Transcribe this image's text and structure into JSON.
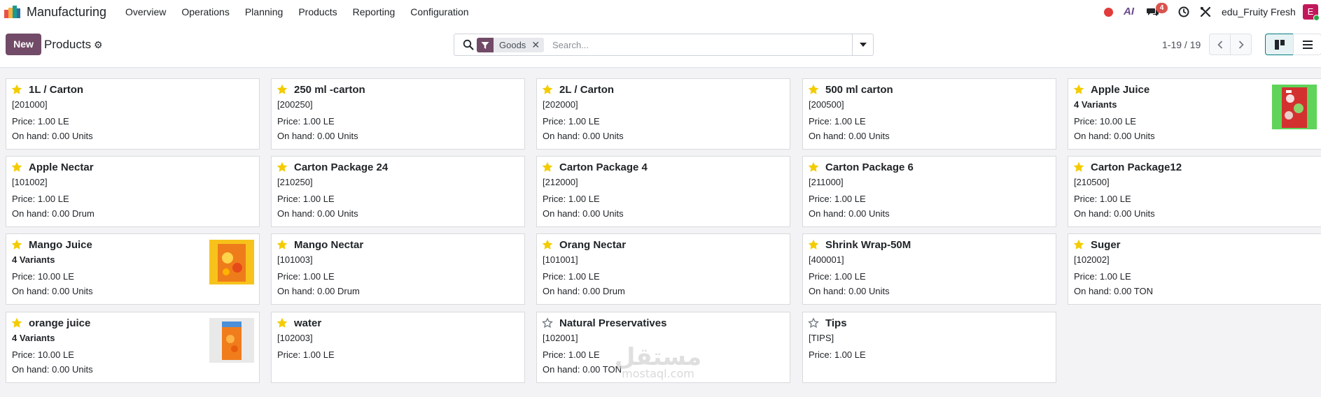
{
  "navbar": {
    "app_name": "Manufacturing",
    "menu": [
      "Overview",
      "Operations",
      "Planning",
      "Products",
      "Reporting",
      "Configuration"
    ],
    "ai_label": "AI",
    "chat_badge": "4",
    "company": "edu_Fruity Fresh",
    "avatar_letter": "E"
  },
  "control": {
    "new_label": "New",
    "title": "Products",
    "facet_label": "Goods",
    "search_placeholder": "Search...",
    "pager": "1-19 / 19"
  },
  "cards": [
    {
      "name": "1L / Carton",
      "line2": "[201000]",
      "line2_bold": false,
      "price": "Price: 1.00 LE",
      "onhand": "On hand: 0.00 Units",
      "starred": true,
      "thumb": ""
    },
    {
      "name": "250 ml -carton",
      "line2": "[200250]",
      "line2_bold": false,
      "price": "Price: 1.00 LE",
      "onhand": "On hand: 0.00 Units",
      "starred": true,
      "thumb": ""
    },
    {
      "name": "2L / Carton",
      "line2": "[202000]",
      "line2_bold": false,
      "price": "Price: 1.00 LE",
      "onhand": "On hand: 0.00 Units",
      "starred": true,
      "thumb": ""
    },
    {
      "name": "500 ml carton",
      "line2": "[200500]",
      "line2_bold": false,
      "price": "Price: 1.00 LE",
      "onhand": "On hand: 0.00 Units",
      "starred": true,
      "thumb": ""
    },
    {
      "name": "Apple Juice",
      "line2": "4 Variants",
      "line2_bold": true,
      "price": "Price: 10.00 LE",
      "onhand": "On hand: 0.00 Units",
      "starred": true,
      "thumb": "apple"
    },
    {
      "name": "Apple Nectar",
      "line2": "[101002]",
      "line2_bold": false,
      "price": "Price: 1.00 LE",
      "onhand": "On hand: 0.00 Drum",
      "starred": true,
      "thumb": ""
    },
    {
      "name": "Carton Package 24",
      "line2": "[210250]",
      "line2_bold": false,
      "price": "Price: 1.00 LE",
      "onhand": "On hand: 0.00 Units",
      "starred": true,
      "thumb": ""
    },
    {
      "name": "Carton Package 4",
      "line2": "[212000]",
      "line2_bold": false,
      "price": "Price: 1.00 LE",
      "onhand": "On hand: 0.00 Units",
      "starred": true,
      "thumb": ""
    },
    {
      "name": "Carton Package 6",
      "line2": "[211000]",
      "line2_bold": false,
      "price": "Price: 1.00 LE",
      "onhand": "On hand: 0.00 Units",
      "starred": true,
      "thumb": ""
    },
    {
      "name": "Carton Package12",
      "line2": "[210500]",
      "line2_bold": false,
      "price": "Price: 1.00 LE",
      "onhand": "On hand: 0.00 Units",
      "starred": true,
      "thumb": ""
    },
    {
      "name": "Mango Juice",
      "line2": "4 Variants",
      "line2_bold": true,
      "price": "Price: 10.00 LE",
      "onhand": "On hand: 0.00 Units",
      "starred": true,
      "thumb": "mango"
    },
    {
      "name": "Mango Nectar",
      "line2": "[101003]",
      "line2_bold": false,
      "price": "Price: 1.00 LE",
      "onhand": "On hand: 0.00 Drum",
      "starred": true,
      "thumb": ""
    },
    {
      "name": "Orang Nectar",
      "line2": "[101001]",
      "line2_bold": false,
      "price": "Price: 1.00 LE",
      "onhand": "On hand: 0.00 Drum",
      "starred": true,
      "thumb": ""
    },
    {
      "name": "Shrink Wrap-50M",
      "line2": "[400001]",
      "line2_bold": false,
      "price": "Price: 1.00 LE",
      "onhand": "On hand: 0.00 Units",
      "starred": true,
      "thumb": ""
    },
    {
      "name": "Suger",
      "line2": "[102002]",
      "line2_bold": false,
      "price": "Price: 1.00 LE",
      "onhand": "On hand: 0.00 TON",
      "starred": true,
      "thumb": ""
    },
    {
      "name": "orange juice",
      "line2": "4 Variants",
      "line2_bold": true,
      "price": "Price: 10.00 LE",
      "onhand": "On hand: 0.00 Units",
      "starred": true,
      "thumb": "orange"
    },
    {
      "name": "water",
      "line2": "[102003]",
      "line2_bold": false,
      "price": "Price: 1.00 LE",
      "onhand": "",
      "starred": true,
      "thumb": ""
    },
    {
      "name": "Natural Preservatives",
      "line2": "[102001]",
      "line2_bold": false,
      "price": "Price: 1.00 LE",
      "onhand": "On hand: 0.00 TON",
      "starred": false,
      "thumb": ""
    },
    {
      "name": "Tips",
      "line2": "[TIPS]",
      "line2_bold": false,
      "price": "Price: 1.00 LE",
      "onhand": "",
      "starred": false,
      "thumb": ""
    }
  ],
  "watermark": {
    "arabic": "مستقل",
    "latin": "mostaql.com"
  },
  "colors": {
    "brand": "#714b67",
    "star": "#f3cc00",
    "accent": "#017e84"
  }
}
